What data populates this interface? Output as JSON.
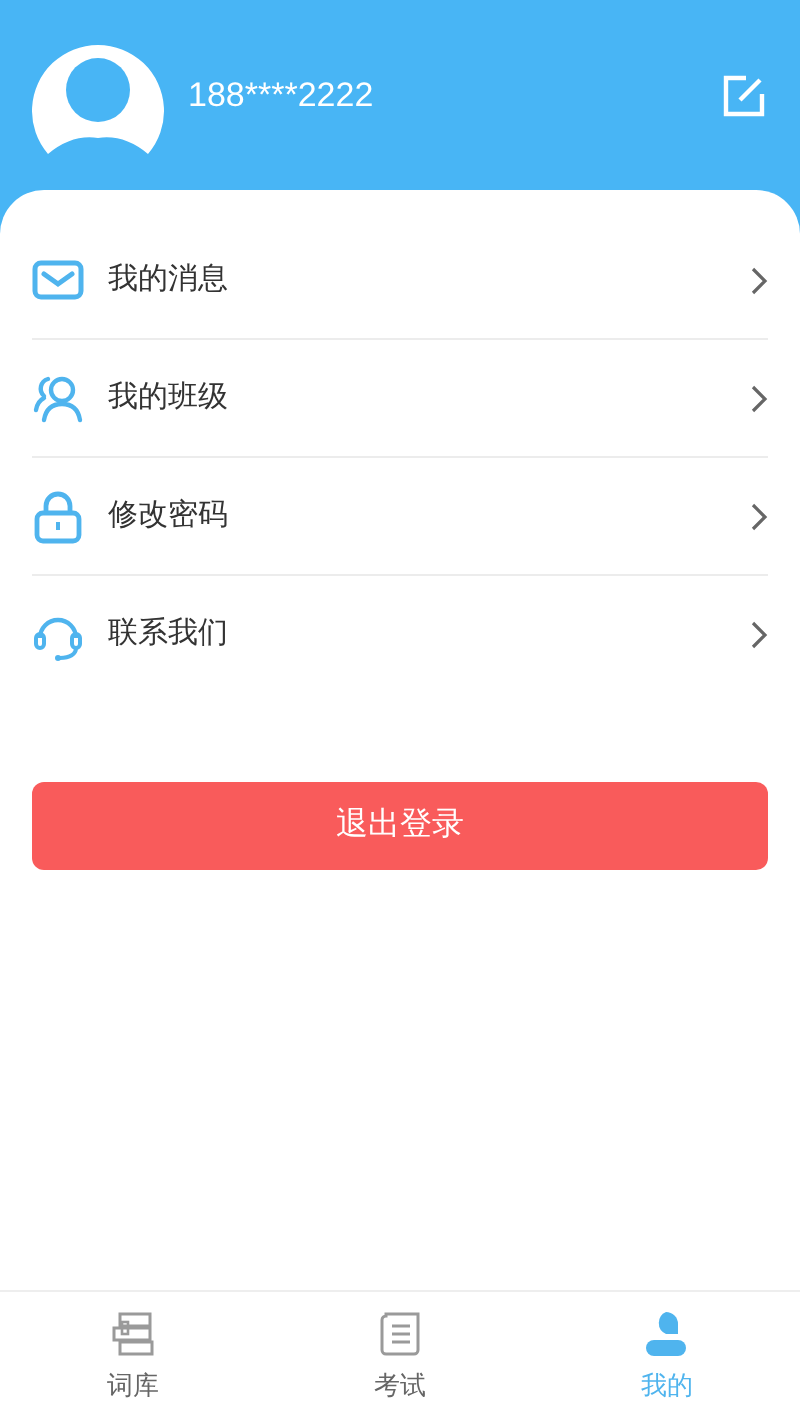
{
  "profile": {
    "phone": "188****2222"
  },
  "menu": [
    {
      "kind": "message",
      "label": "我的消息"
    },
    {
      "kind": "class",
      "label": "我的班级"
    },
    {
      "kind": "password",
      "label": "修改密码"
    },
    {
      "kind": "contact",
      "label": "联系我们"
    }
  ],
  "logout_button": "退出登录",
  "tabs": [
    {
      "kind": "words",
      "label": "词库",
      "selected": false
    },
    {
      "kind": "exam",
      "label": "考试",
      "selected": false
    },
    {
      "kind": "me",
      "label": "我的",
      "selected": true
    }
  ]
}
